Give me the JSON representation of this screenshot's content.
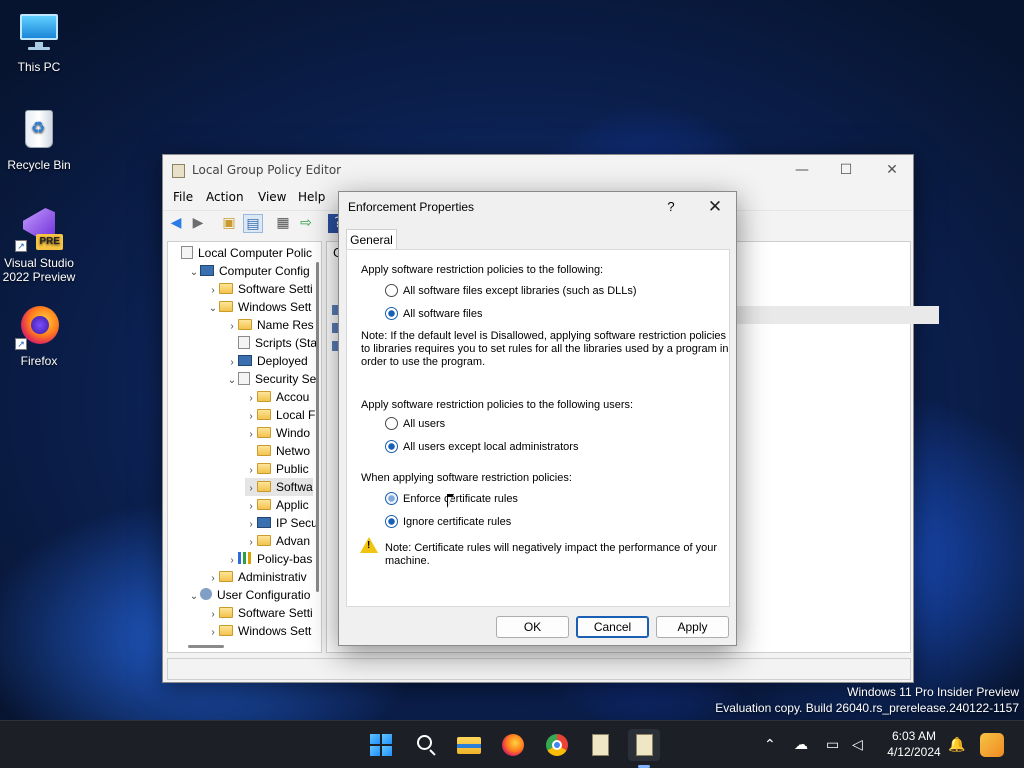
{
  "desktop": {
    "icons": [
      {
        "label": "This PC"
      },
      {
        "label": "Recycle Bin"
      },
      {
        "label": "Visual Studio 2022 Preview",
        "line1": "Visual Studio",
        "line2": "2022 Preview",
        "badge": "PRE"
      },
      {
        "label": "Firefox"
      }
    ],
    "watermark": {
      "line1": "Windows 11 Pro Insider Preview",
      "line2": "Evaluation copy. Build 26040.rs_prerelease.240122-1157"
    }
  },
  "gpe_window": {
    "title": "Local Group Policy Editor",
    "menu": [
      "File",
      "Action",
      "View",
      "Help"
    ],
    "right_pane_header_fragment": "C",
    "tree": [
      {
        "label": "Local Computer Polic",
        "icon": "doc-icon",
        "chev": ""
      },
      {
        "label": "Computer Config",
        "icon": "computer-icon",
        "chev": "v"
      },
      {
        "label": "Software Setti",
        "icon": "folder-icon",
        "chev": ">"
      },
      {
        "label": "Windows Sett",
        "icon": "folder-icon",
        "chev": "v"
      },
      {
        "label": "Name Res",
        "icon": "folder-icon",
        "chev": ">"
      },
      {
        "label": "Scripts (Sta",
        "icon": "doc-icon",
        "chev": ""
      },
      {
        "label": "Deployed",
        "icon": "printer-icon",
        "chev": ">"
      },
      {
        "label": "Security Se",
        "icon": "shield-icon",
        "chev": "v"
      },
      {
        "label": "Accou",
        "icon": "folder-icon",
        "chev": ">"
      },
      {
        "label": "Local F",
        "icon": "folder-icon",
        "chev": ">"
      },
      {
        "label": "Windo",
        "icon": "folder-icon",
        "chev": ">"
      },
      {
        "label": "Netwo",
        "icon": "folder-icon",
        "chev": ""
      },
      {
        "label": "Public",
        "icon": "folder-icon",
        "chev": ">"
      },
      {
        "label": "Softwa",
        "icon": "folder-icon",
        "chev": ">",
        "selected": true
      },
      {
        "label": "Applic",
        "icon": "folder-icon",
        "chev": ">"
      },
      {
        "label": "IP Secu",
        "icon": "computer-icon",
        "chev": ">"
      },
      {
        "label": "Advan",
        "icon": "folder-icon",
        "chev": ">"
      },
      {
        "label": "Policy-bas",
        "icon": "chart-icon",
        "chev": ">"
      },
      {
        "label": "Administrativ",
        "icon": "folder-icon",
        "chev": ">"
      },
      {
        "label": "User Configuratio",
        "icon": "user-icon",
        "chev": "v"
      },
      {
        "label": "Software Setti",
        "icon": "folder-icon",
        "chev": ">"
      },
      {
        "label": "Windows Sett",
        "icon": "folder-icon",
        "chev": ">"
      }
    ]
  },
  "dialog": {
    "title": "Enforcement Properties",
    "help": "?",
    "close": "✕",
    "tab": "General",
    "section1": {
      "heading": "Apply software restriction policies to the following:",
      "options": [
        {
          "label": "All software files except libraries (such as DLLs)",
          "checked": false
        },
        {
          "label": "All software files",
          "checked": true
        }
      ],
      "note_line1": "Note:  If the default level is Disallowed, applying software restriction policies",
      "note_line2": "to libraries requires you to set rules for all the libraries used by a program in",
      "note_line3": "order to use the program."
    },
    "section2": {
      "heading": "Apply software restriction policies to the following users:",
      "options": [
        {
          "label": "All users",
          "checked": false
        },
        {
          "label": "All users except local administrators",
          "checked": true
        }
      ]
    },
    "section3": {
      "heading": "When applying software restriction policies:",
      "options": [
        {
          "label": "Enforce certificate rules",
          "checked": false
        },
        {
          "label": "Ignore certificate rules",
          "checked": true
        }
      ],
      "warning_line1": "Note:  Certificate rules will negatively impact the performance of your",
      "warning_line2": "machine."
    },
    "buttons": {
      "ok": "OK",
      "cancel": "Cancel",
      "apply": "Apply"
    }
  },
  "taskbar": {
    "time": "6:03 AM",
    "date": "4/12/2024",
    "accent": "#1a5fb4"
  }
}
